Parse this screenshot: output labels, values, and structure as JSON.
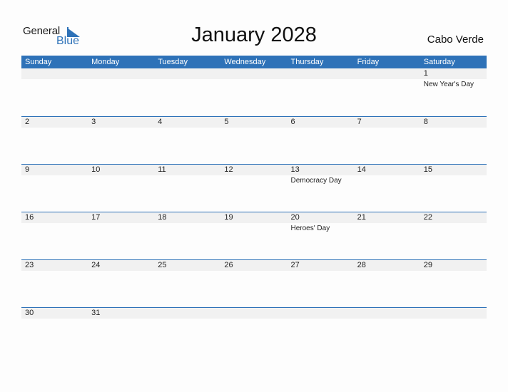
{
  "logo": {
    "general": "General",
    "blue": "Blue"
  },
  "title": "January 2028",
  "country": "Cabo Verde",
  "colors": {
    "accent": "#2e72b8",
    "band": "#f1f1f1"
  },
  "weekdays": [
    "Sunday",
    "Monday",
    "Tuesday",
    "Wednesday",
    "Thursday",
    "Friday",
    "Saturday"
  ],
  "weeks": [
    [
      {
        "d": ""
      },
      {
        "d": ""
      },
      {
        "d": ""
      },
      {
        "d": ""
      },
      {
        "d": ""
      },
      {
        "d": ""
      },
      {
        "d": "1",
        "h": "New Year's Day"
      }
    ],
    [
      {
        "d": "2"
      },
      {
        "d": "3"
      },
      {
        "d": "4"
      },
      {
        "d": "5"
      },
      {
        "d": "6"
      },
      {
        "d": "7"
      },
      {
        "d": "8"
      }
    ],
    [
      {
        "d": "9"
      },
      {
        "d": "10"
      },
      {
        "d": "11"
      },
      {
        "d": "12"
      },
      {
        "d": "13",
        "h": "Democracy Day"
      },
      {
        "d": "14"
      },
      {
        "d": "15"
      }
    ],
    [
      {
        "d": "16"
      },
      {
        "d": "17"
      },
      {
        "d": "18"
      },
      {
        "d": "19"
      },
      {
        "d": "20",
        "h": "Heroes' Day"
      },
      {
        "d": "21"
      },
      {
        "d": "22"
      }
    ],
    [
      {
        "d": "23"
      },
      {
        "d": "24"
      },
      {
        "d": "25"
      },
      {
        "d": "26"
      },
      {
        "d": "27"
      },
      {
        "d": "28"
      },
      {
        "d": "29"
      }
    ],
    [
      {
        "d": "30"
      },
      {
        "d": "31"
      },
      {
        "d": ""
      },
      {
        "d": ""
      },
      {
        "d": ""
      },
      {
        "d": ""
      },
      {
        "d": ""
      }
    ]
  ]
}
